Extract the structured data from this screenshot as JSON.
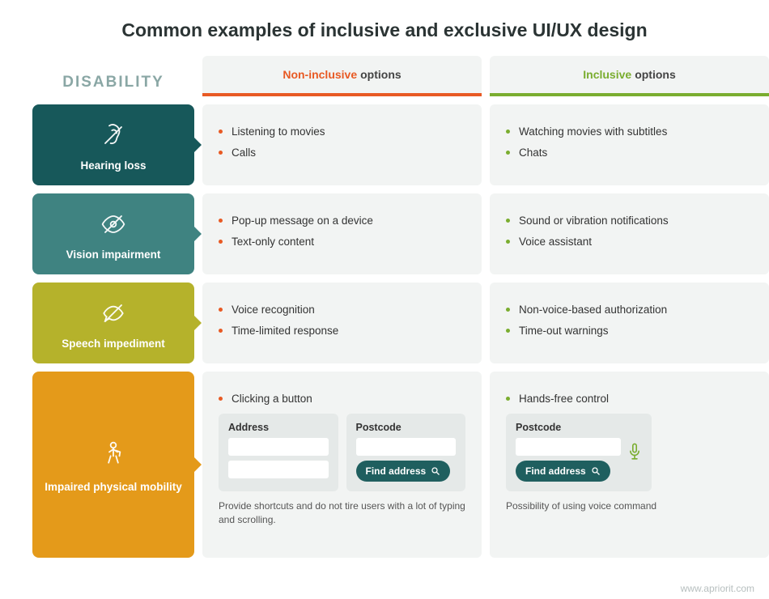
{
  "title": "Common examples of inclusive and exclusive UI/UX design",
  "columns": {
    "disability": "DISABILITY",
    "noninc_accent": "Non-inclusive",
    "noninc_rest": "options",
    "inc_accent": "Inclusive",
    "inc_rest": "options"
  },
  "rows": [
    {
      "label": "Hearing loss",
      "color": "#17585a",
      "icon": "ear-off-icon",
      "noninc": [
        "Listening to movies",
        "Calls"
      ],
      "inc": [
        "Watching movies with subtitles",
        "Chats"
      ]
    },
    {
      "label": "Vision impairment",
      "color": "#3f8381",
      "icon": "eye-off-icon",
      "noninc": [
        "Pop-up message on a device",
        "Text-only content"
      ],
      "inc": [
        "Sound or vibration notifications",
        "Voice assistant"
      ]
    },
    {
      "label": "Speech impediment",
      "color": "#b5b22b",
      "icon": "speech-off-icon",
      "noninc": [
        "Voice recognition",
        "Time-limited response"
      ],
      "inc": [
        "Non-voice-based authorization",
        "Time-out warnings"
      ]
    },
    {
      "label": "Impaired physical mobility",
      "color": "#e49a1a",
      "icon": "mobility-icon",
      "noninc": [
        "Clicking a button"
      ],
      "inc": [
        "Hands-free control"
      ],
      "form_noninc": {
        "address_label": "Address",
        "postcode_label": "Postcode",
        "button": "Find address",
        "caption": "Provide shortcuts and do not tire users with a lot of typing and scrolling."
      },
      "form_inc": {
        "postcode_label": "Postcode",
        "button": "Find address",
        "caption": "Possibility of using voice command"
      }
    }
  ],
  "footer": "www.apriorit.com"
}
